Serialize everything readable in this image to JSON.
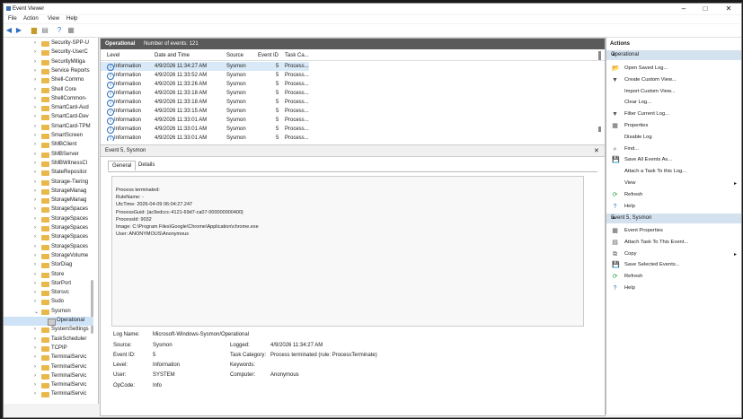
{
  "window": {
    "title": "Event Viewer",
    "minimize": "–",
    "maximize": "□",
    "close": "✕"
  },
  "menu": [
    "File",
    "Action",
    "View",
    "Help"
  ],
  "tree": [
    {
      "label": "Security-SPP-U",
      "chev": "›"
    },
    {
      "label": "Security-UserC",
      "chev": "›"
    },
    {
      "label": "SecurityMitiga",
      "chev": "›"
    },
    {
      "label": "Service Reports",
      "chev": "›"
    },
    {
      "label": "Shell-Commo",
      "chev": "›"
    },
    {
      "label": "Shell Core",
      "chev": "›"
    },
    {
      "label": "ShellCommon-",
      "chev": "›"
    },
    {
      "label": "SmartCard-Aud",
      "chev": "›"
    },
    {
      "label": "SmartCard-Dev",
      "chev": "›"
    },
    {
      "label": "SmartCard-TPM",
      "chev": "›"
    },
    {
      "label": "SmartScreen",
      "chev": "›"
    },
    {
      "label": "SMBClient",
      "chev": "›"
    },
    {
      "label": "SMBServer",
      "chev": "›"
    },
    {
      "label": "SMBWitnessCl",
      "chev": "›"
    },
    {
      "label": "StateRepositor",
      "chev": "›"
    },
    {
      "label": "Storage-Tiering",
      "chev": "›"
    },
    {
      "label": "StorageManag",
      "chev": "›"
    },
    {
      "label": "StorageManag",
      "chev": "›"
    },
    {
      "label": "StorageSpaces",
      "chev": "›"
    },
    {
      "label": "StorageSpaces",
      "chev": "›"
    },
    {
      "label": "StorageSpaces",
      "chev": "›"
    },
    {
      "label": "StorageSpaces",
      "chev": "›"
    },
    {
      "label": "StorageSpaces",
      "chev": "›"
    },
    {
      "label": "StorageVolume",
      "chev": "›"
    },
    {
      "label": "StorDiag",
      "chev": "›"
    },
    {
      "label": "Store",
      "chev": "›"
    },
    {
      "label": "StorPort",
      "chev": "›"
    },
    {
      "label": "Storsvc",
      "chev": "›"
    },
    {
      "label": "Sudo",
      "chev": "›"
    },
    {
      "label": "Sysmon",
      "chev": "⌄"
    },
    {
      "label": "Operational",
      "leaf": true
    },
    {
      "label": "SystemSettings",
      "chev": "›"
    },
    {
      "label": "TaskScheduler",
      "chev": "›"
    },
    {
      "label": "TCPIP",
      "chev": "›"
    },
    {
      "label": "TerminalServic",
      "chev": "›"
    },
    {
      "label": "TerminalServic",
      "chev": "›"
    },
    {
      "label": "TerminalServic",
      "chev": "›"
    },
    {
      "label": "TerminalServic",
      "chev": "›"
    },
    {
      "label": "TerminalServic",
      "chev": "›"
    }
  ],
  "log_header": {
    "title": "Operational",
    "count": "Number of events: 121"
  },
  "grid": {
    "columns": [
      "Level",
      "Date and Time",
      "Source",
      "Event ID",
      "Task Ca..."
    ],
    "rows": [
      [
        "Information",
        "4/9/2026 11:34:27 AM",
        "Sysmon",
        "5",
        "Process..."
      ],
      [
        "Information",
        "4/9/2026 11:33:52 AM",
        "Sysmon",
        "5",
        "Process..."
      ],
      [
        "Information",
        "4/9/2026 11:33:26 AM",
        "Sysmon",
        "5",
        "Process..."
      ],
      [
        "Information",
        "4/9/2026 11:33:18 AM",
        "Sysmon",
        "5",
        "Process..."
      ],
      [
        "Information",
        "4/9/2026 11:33:18 AM",
        "Sysmon",
        "5",
        "Process..."
      ],
      [
        "Information",
        "4/9/2026 11:33:15 AM",
        "Sysmon",
        "5",
        "Process..."
      ],
      [
        "Information",
        "4/9/2026 11:33:01 AM",
        "Sysmon",
        "5",
        "Process..."
      ],
      [
        "Information",
        "4/9/2026 11:33:01 AM",
        "Sysmon",
        "5",
        "Process..."
      ],
      [
        "Information",
        "4/9/2026 11:33:01 AM",
        "Sysmon",
        "5",
        "Process..."
      ]
    ]
  },
  "event": {
    "header": "Event 5, Sysmon",
    "close": "✕",
    "tabs": [
      "General",
      "Details"
    ],
    "description": [
      "Process terminated:",
      "RuleName: -",
      "UtcTime: 2026-04-09 06:04:27.247",
      "ProcessGuid: {ac9edccc-4121-69d7-ca07-000000000400}",
      "ProcessId: 9032",
      "Image: C:\\Program Files\\Google\\Chrome\\Application\\chrome.exe",
      "User: ANONYMOUS\\Anonymous"
    ],
    "fields": {
      "log_name_label": "Log Name:",
      "log_name": "Microsoft-Windows-Sysmon/Operational",
      "source_label": "Source:",
      "source": "Sysmon",
      "logged_label": "Logged:",
      "logged": "4/9/2026 11:34:27 AM",
      "event_id_label": "Event ID:",
      "event_id": "5",
      "task_label": "Task Category:",
      "task": "Process terminated (rule: ProcessTerminate)",
      "level_label": "Level:",
      "level": "Information",
      "keywords_label": "Keywords:",
      "keywords": "",
      "user_label": "User:",
      "user": "SYSTEM",
      "computer_label": "Computer:",
      "computer": "Anonymous",
      "opcode_label": "OpCode:",
      "opcode": "Info"
    }
  },
  "actions": {
    "header": "Actions",
    "section1": "Operational",
    "items1": [
      {
        "icon": "open-folder-icon",
        "glyph": "📂",
        "label": "Open Saved Log..."
      },
      {
        "icon": "filter-icon",
        "glyph": "▼",
        "label": "Create Custom View..."
      },
      {
        "icon": "blank-icon",
        "glyph": "",
        "label": "Import Custom View..."
      },
      {
        "icon": "blank-icon",
        "glyph": "",
        "label": "Clear Log..."
      },
      {
        "icon": "filter-icon",
        "glyph": "▼",
        "label": "Filter Current Log..."
      },
      {
        "icon": "properties-icon",
        "glyph": "▦",
        "label": "Properties"
      },
      {
        "icon": "blank-icon",
        "glyph": "",
        "label": "Disable Log"
      },
      {
        "icon": "find-icon",
        "glyph": "⌕",
        "label": "Find..."
      },
      {
        "icon": "save-icon",
        "glyph": "💾",
        "label": "Save All Events As..."
      },
      {
        "icon": "blank-icon",
        "glyph": "",
        "label": "Attach a Task To this Log..."
      },
      {
        "icon": "blank-icon",
        "glyph": "",
        "label": "View",
        "arrow": "▸"
      },
      {
        "icon": "refresh-icon",
        "glyph": "⟳",
        "label": "Refresh"
      },
      {
        "icon": "help-icon",
        "glyph": "?",
        "label": "Help"
      }
    ],
    "section2": "Event 5, Sysmon",
    "items2": [
      {
        "icon": "properties-icon",
        "glyph": "▦",
        "label": "Event Properties"
      },
      {
        "icon": "task-icon",
        "glyph": "▤",
        "label": "Attach Task To This Event..."
      },
      {
        "icon": "copy-icon",
        "glyph": "⧉",
        "label": "Copy",
        "arrow": "▸"
      },
      {
        "icon": "save-icon",
        "glyph": "💾",
        "label": "Save Selected Events..."
      },
      {
        "icon": "refresh-icon",
        "glyph": "⟳",
        "label": "Refresh"
      },
      {
        "icon": "help-icon",
        "glyph": "?",
        "label": "Help"
      }
    ],
    "collapse": "▲"
  },
  "colors": {
    "header_dark": "#5a5a5a",
    "section_blue": "#d4e1ef",
    "selection": "#cfe3f7",
    "folder": "#e8b84a"
  }
}
